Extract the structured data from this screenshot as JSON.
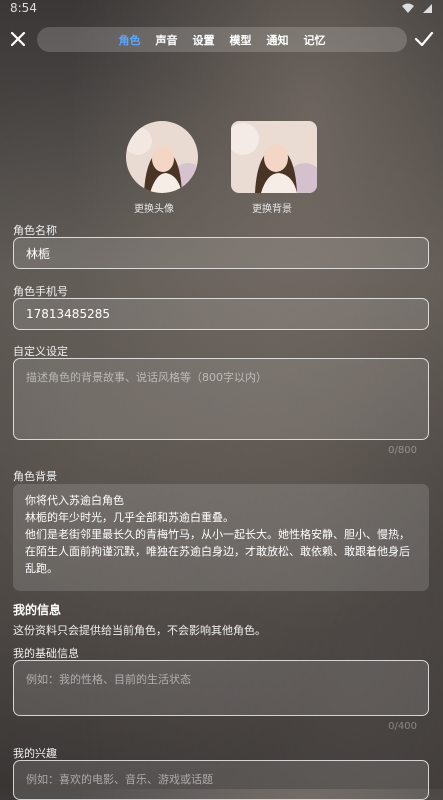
{
  "status": {
    "time": "8:54"
  },
  "tabs": [
    "角色",
    "声音",
    "设置",
    "模型",
    "通知",
    "记忆"
  ],
  "avatar": {
    "change_avatar": "更换头像",
    "change_background": "更换背景"
  },
  "role_name": {
    "label": "角色名称",
    "value": "林栀"
  },
  "role_phone": {
    "label": "角色手机号",
    "value": "17813485285"
  },
  "custom_setting": {
    "label": "自定义设定",
    "placeholder": "描述角色的背景故事、说话风格等（800字以内）",
    "counter": "0/800"
  },
  "role_background": {
    "label": "角色背景",
    "lines": [
      "你将代入苏逾白角色",
      "林栀的年少时光，几乎全部和苏逾白重叠。",
      "他们是老街邻里最长久的青梅竹马，从小一起长大。她性格安静、胆小、慢热，",
      "在陌生人面前拘谨沉默，唯独在苏逾白身边，才敢放松、敢依赖、敢跟着他身后",
      "乱跑。"
    ]
  },
  "my_info": {
    "title": "我的信息",
    "desc": "这份资料只会提供给当前角色，不会影响其他角色。",
    "basic_label": "我的基础信息",
    "basic_placeholder": "例如：我的性格、目前的生活状态",
    "basic_counter": "0/400",
    "interests_label": "我的兴趣",
    "interests_placeholder": "例如：喜欢的电影、音乐、游戏或话题"
  },
  "colors": {
    "active_tab": "#5aa6ff"
  },
  "icons": {
    "close": "close-icon",
    "confirm": "check-icon",
    "wifi": "wifi-icon",
    "battery": "battery-icon"
  }
}
